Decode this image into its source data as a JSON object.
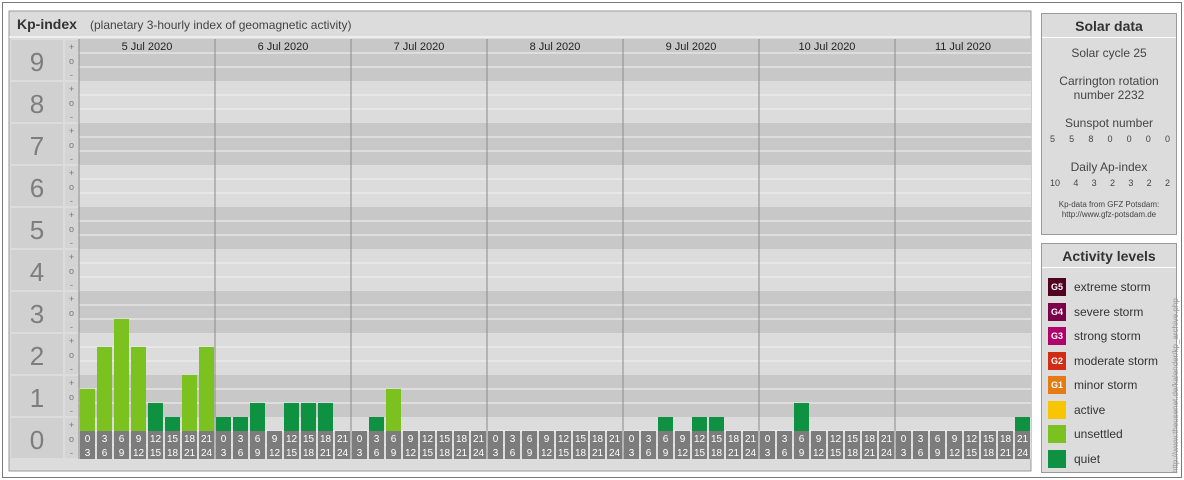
{
  "header": {
    "title": "Kp-index",
    "subtitle": "(planetary 3-hourly index of geomagnetic activity)"
  },
  "chart_data": {
    "type": "bar",
    "title": "Kp-index",
    "subtitle": "(planetary 3-hourly index of geomagnetic activity)",
    "ylim": [
      0,
      9
    ],
    "y_ticks": [
      "0",
      "1",
      "2",
      "3",
      "4",
      "5",
      "6",
      "7",
      "8",
      "9"
    ],
    "y_minor_marks": [
      "+",
      "o",
      "-"
    ],
    "days": [
      "5 Jul 2020",
      "6 Jul 2020",
      "7 Jul 2020",
      "8 Jul 2020",
      "9 Jul 2020",
      "10 Jul 2020",
      "11 Jul 2020"
    ],
    "hour_top_labels": [
      "0",
      "3",
      "6",
      "9",
      "12",
      "15",
      "18",
      "21"
    ],
    "hour_bottom_labels": [
      "3",
      "6",
      "9",
      "12",
      "15",
      "18",
      "21",
      "24"
    ],
    "series": [
      {
        "values": [
          1.667,
          2.667,
          3.333,
          2.667,
          1.333,
          1.0,
          2.0,
          2.667,
          1.0,
          1.0,
          1.333,
          0.667,
          1.333,
          1.333,
          1.333,
          0.333,
          0.333,
          1.0,
          1.667,
          0.333,
          0.333,
          0.333,
          0.333,
          0.667,
          0.0,
          0.667,
          0.333,
          0.333,
          0.333,
          0.333,
          0.333,
          0.333,
          0.333,
          0.333,
          1.0,
          0.667,
          1.0,
          1.0,
          0.667,
          0.0,
          0.0,
          0.333,
          1.333,
          0.333,
          0.333,
          0.333,
          0.333,
          0.0,
          0.667,
          0.333,
          0.0,
          0.333,
          0.333,
          0.333,
          0.667,
          1.0
        ]
      }
    ],
    "grid": true,
    "band_colors": {
      "odd": "#c8c8c8",
      "even": "#dcdcdc",
      "gridline": "#f2f2f2"
    },
    "axis_colors": {
      "y_label_bg": "#d0d0d0",
      "y_label_text": "#7d7d7d",
      "day_line": "#8a8a8a",
      "hour_cell_bg": "#7c7c7c",
      "hour_cell_text": "#ffffff"
    }
  },
  "solar": {
    "title": "Solar data",
    "cycle": "Solar cycle 25",
    "carrington_line1": "Carrington rotation",
    "carrington_line2": "number 2232",
    "sunspot_title": "Sunspot number",
    "sunspot_values": [
      "5",
      "5",
      "8",
      "0",
      "0",
      "0",
      "0"
    ],
    "ap_title": "Daily Ap-index",
    "ap_values": [
      "10",
      "4",
      "3",
      "2",
      "3",
      "2",
      "2"
    ],
    "credit_line1": "Kp-data from GFZ Potsdam:",
    "credit_line2": "http://www.gfz-potsdam.de"
  },
  "activity": {
    "title": "Activity levels",
    "levels": [
      {
        "code": "G5",
        "label": "extreme storm",
        "color": "#520021"
      },
      {
        "code": "G4",
        "label": "severe storm",
        "color": "#7c0049"
      },
      {
        "code": "G3",
        "label": "strong storm",
        "color": "#b0006a"
      },
      {
        "code": "G2",
        "label": "moderate storm",
        "color": "#d12c15"
      },
      {
        "code": "G1",
        "label": "minor storm",
        "color": "#e47b13"
      },
      {
        "code": "",
        "label": "active",
        "color": "#f7c600"
      },
      {
        "code": "",
        "label": "unsettled",
        "color": "#7bc11f"
      },
      {
        "code": "",
        "label": "quiet",
        "color": "#0f9142"
      }
    ]
  },
  "watermark": "http://www.theusenet.de/kalender/kp_archive.php"
}
